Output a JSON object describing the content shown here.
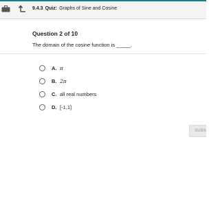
{
  "header": {
    "quiz_number": "9.4.3",
    "quiz_kind": "Quiz:",
    "quiz_title": "Graphs of Sine and Cosine",
    "accent_color": "#1c7a8c"
  },
  "question": {
    "heading": "Question 2 of 10",
    "text": "The domain of the cosine function is _____."
  },
  "options": [
    {
      "letter": "A.",
      "text": "π"
    },
    {
      "letter": "B.",
      "text": "2π"
    },
    {
      "letter": "C.",
      "text": "all real numbers"
    },
    {
      "letter": "D.",
      "text": "[-1,1]"
    }
  ],
  "submit": {
    "label": "SUBMIT"
  }
}
